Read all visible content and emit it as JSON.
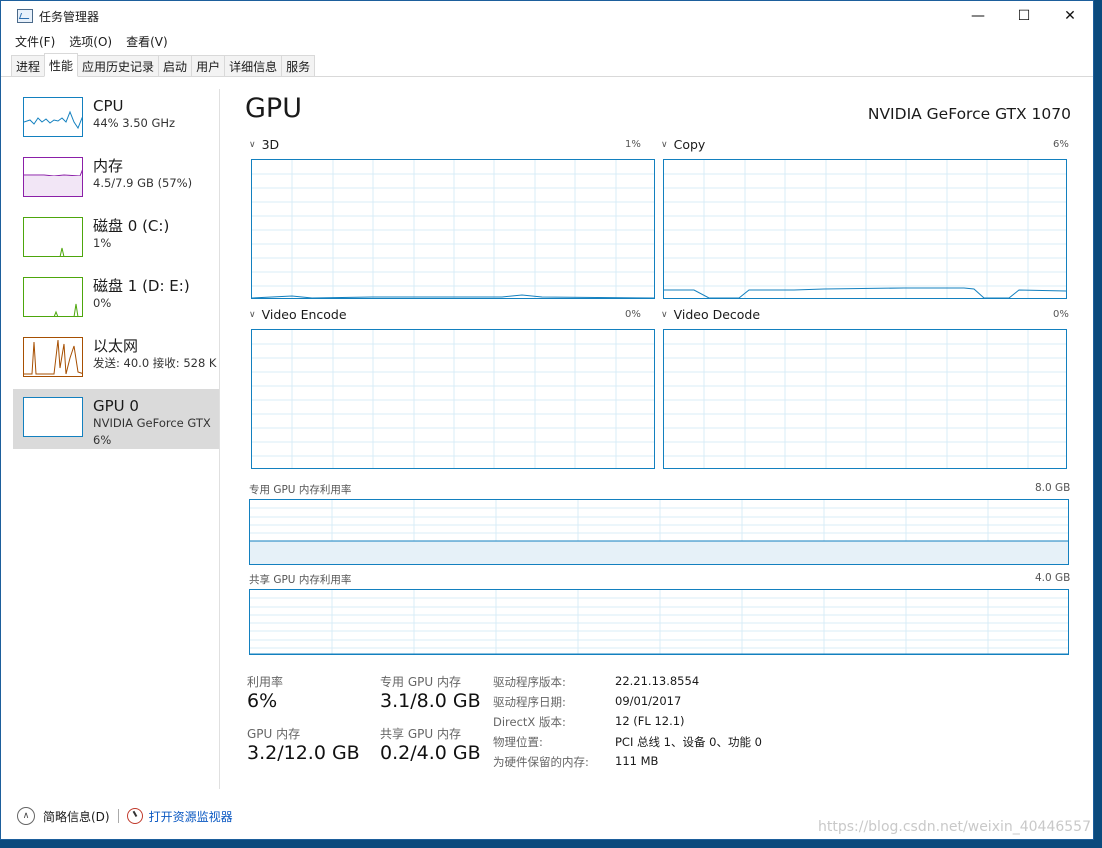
{
  "window": {
    "title": "任务管理器",
    "minimize": "—",
    "maximize": "☐",
    "close": "✕"
  },
  "menu": [
    "文件(F)",
    "选项(O)",
    "查看(V)"
  ],
  "tabs": [
    "进程",
    "性能",
    "应用历史记录",
    "启动",
    "用户",
    "详细信息",
    "服务"
  ],
  "sidebar": [
    {
      "title": "CPU",
      "sub1": "44%  3.50 GHz",
      "sub2": "",
      "color": "#1380bf"
    },
    {
      "title": "内存",
      "sub1": "4.5/7.9 GB (57%)",
      "sub2": "",
      "color": "#8b1fa8"
    },
    {
      "title": "磁盘 0 (C:)",
      "sub1": "1%",
      "sub2": "",
      "color": "#4da60c"
    },
    {
      "title": "磁盘 1 (D: E:)",
      "sub1": "0%",
      "sub2": "",
      "color": "#4da60c"
    },
    {
      "title": "以太网",
      "sub1": "发送: 40.0  接收: 528 K",
      "sub2": "",
      "color": "#a74f01"
    },
    {
      "title": "GPU 0",
      "sub1": "NVIDIA GeForce GTX",
      "sub2": "6%",
      "color": "#1380bf"
    }
  ],
  "main": {
    "title": "GPU",
    "model": "NVIDIA GeForce GTX 1070",
    "panels": [
      {
        "label": "3D",
        "pct": "1%"
      },
      {
        "label": "Copy",
        "pct": "6%"
      },
      {
        "label": "Video Encode",
        "pct": "0%"
      },
      {
        "label": "Video Decode",
        "pct": "0%"
      }
    ],
    "dedicated_label": "专用 GPU 内存利用率",
    "dedicated_max": "8.0 GB",
    "shared_label": "共享 GPU 内存利用率",
    "shared_max": "4.0 GB"
  },
  "stats": {
    "util_label": "利用率",
    "util_value": "6%",
    "dedicated_label": "专用 GPU 内存",
    "dedicated_value": "3.1/8.0 GB",
    "gpu_mem_label": "GPU 内存",
    "gpu_mem_value": "3.2/12.0 GB",
    "shared_label": "共享 GPU 内存",
    "shared_value": "0.2/4.0 GB"
  },
  "info": [
    {
      "key": "驱动程序版本:",
      "value": "22.21.13.8554"
    },
    {
      "key": "驱动程序日期:",
      "value": "09/01/2017"
    },
    {
      "key": "DirectX 版本:",
      "value": "12 (FL 12.1)"
    },
    {
      "key": "物理位置:",
      "value": "PCI 总线 1、设备 0、功能 0"
    },
    {
      "key": "为硬件保留的内存:",
      "value": "111 MB"
    }
  ],
  "footer": {
    "brief": "简略信息(D)",
    "open_monitor": "打开资源监视器"
  },
  "watermark": "https://blog.csdn.net/weixin_40446557"
}
